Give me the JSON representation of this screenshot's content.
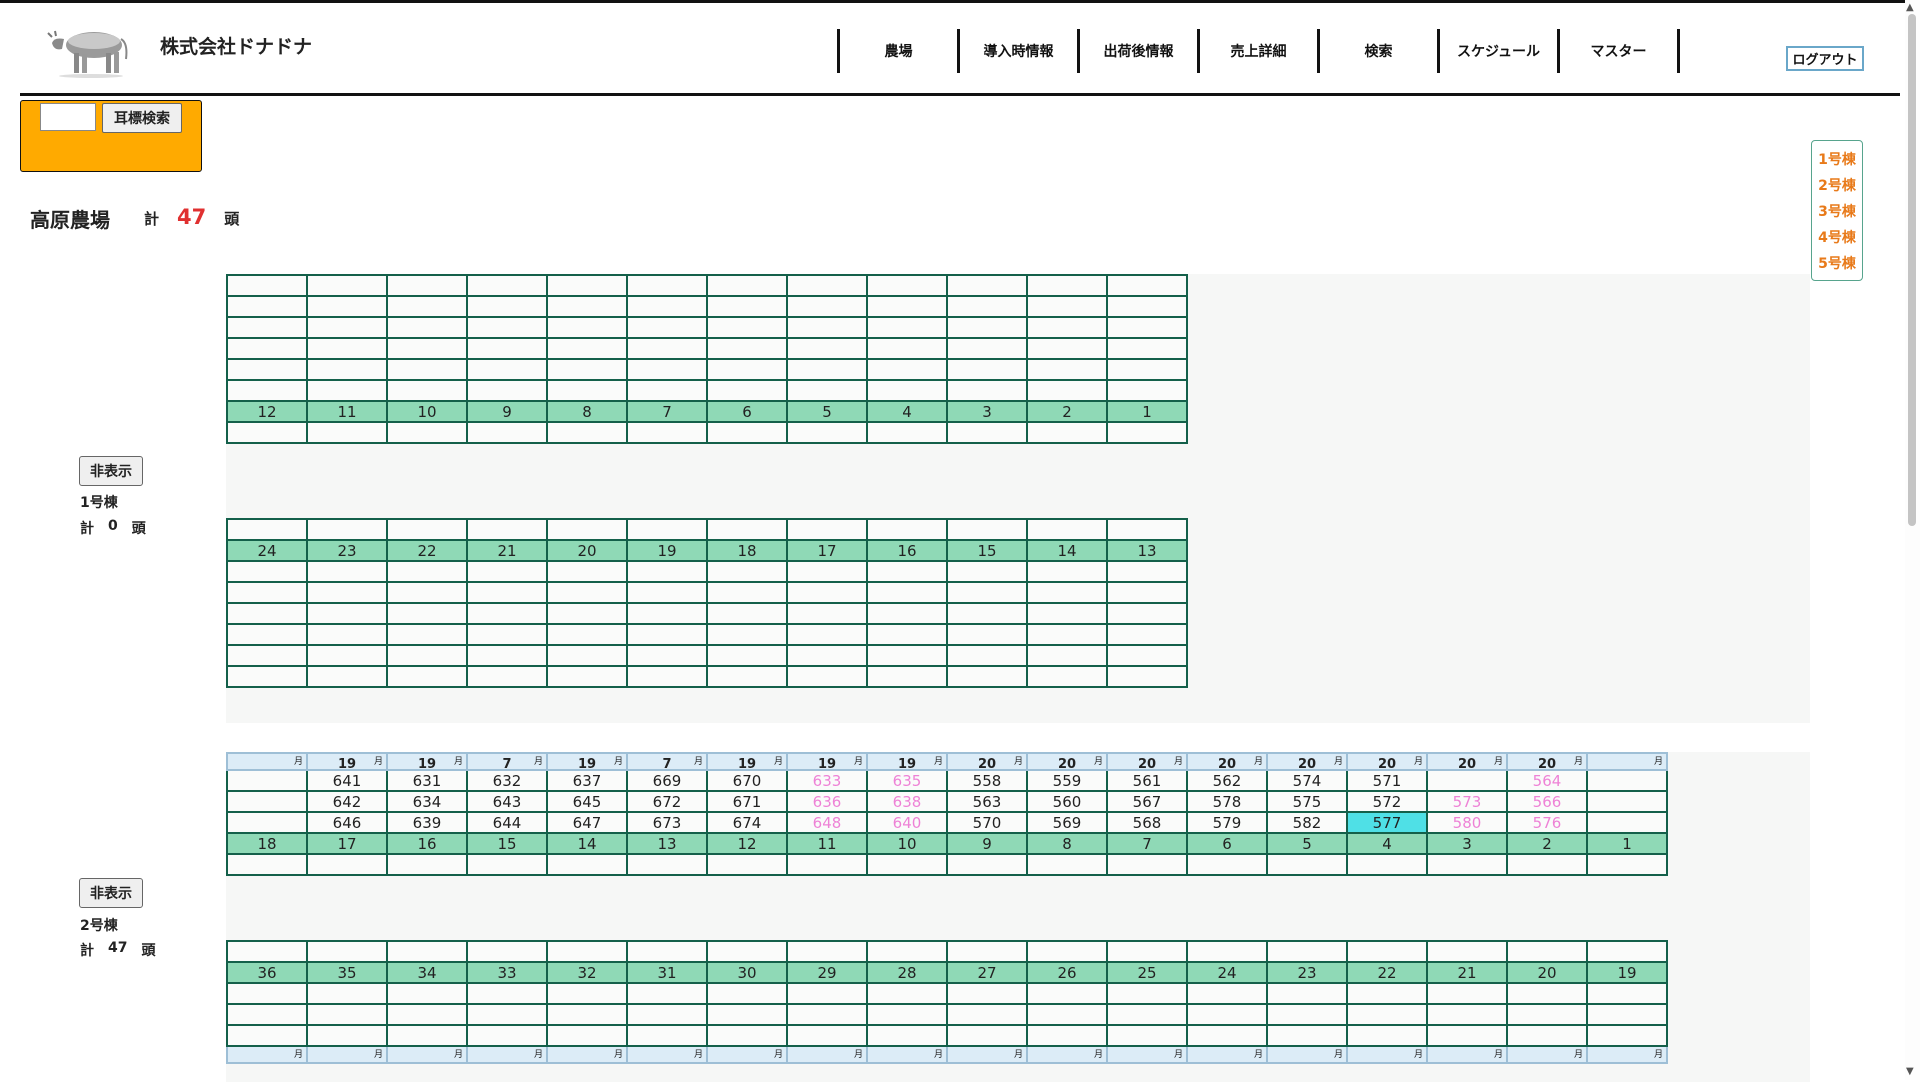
{
  "header": {
    "company": "株式会社ドナドナ",
    "nav": [
      "農場",
      "導入時情報",
      "出荷後情報",
      "売上詳細",
      "検索",
      "スケジュール",
      "マスター"
    ],
    "logout": "ログアウト",
    "logo_icon": "cow-logo"
  },
  "search": {
    "button": "耳標検索",
    "value": ""
  },
  "farm": {
    "name": "高原農場",
    "total_label": "計",
    "total": "47",
    "unit": "頭"
  },
  "barn_nav": [
    "1号棟",
    "2号棟",
    "3号棟",
    "4号棟",
    "5号棟"
  ],
  "barns": [
    {
      "hide_label": "非表示",
      "name": "1号棟",
      "total_label": "計",
      "total": "0",
      "unit": "頭",
      "upper_pens": [
        "12",
        "11",
        "10",
        "9",
        "8",
        "7",
        "6",
        "5",
        "4",
        "3",
        "2",
        "1"
      ],
      "lower_pens": [
        "24",
        "23",
        "22",
        "21",
        "20",
        "19",
        "18",
        "17",
        "16",
        "15",
        "14",
        "13"
      ]
    },
    {
      "hide_label": "非表示",
      "name": "2号棟",
      "total_label": "計",
      "total": "47",
      "unit": "頭",
      "month_unit": "月",
      "dates": [
        "",
        "19",
        "19",
        "7",
        "19",
        "7",
        "19",
        "19",
        "19",
        "20",
        "20",
        "20",
        "20",
        "20",
        "20",
        "20",
        "20",
        ""
      ],
      "cattle_rows": [
        [
          "",
          "641",
          "631",
          "632",
          "637",
          "669",
          "670",
          "633",
          "635",
          "558",
          "559",
          "561",
          "562",
          "574",
          "571",
          "",
          "564",
          ""
        ],
        [
          "",
          "642",
          "634",
          "643",
          "645",
          "672",
          "671",
          "636",
          "638",
          "563",
          "560",
          "567",
          "578",
          "575",
          "572",
          "573",
          "566",
          ""
        ],
        [
          "",
          "646",
          "639",
          "644",
          "647",
          "673",
          "674",
          "648",
          "640",
          "570",
          "569",
          "568",
          "579",
          "582",
          "577",
          "580",
          "576",
          ""
        ]
      ],
      "pink_ids": [
        "633",
        "635",
        "636",
        "638",
        "648",
        "640",
        "573",
        "580",
        "564",
        "566",
        "576"
      ],
      "highlight_ids": [
        "577"
      ],
      "upper_pens": [
        "18",
        "17",
        "16",
        "15",
        "14",
        "13",
        "12",
        "11",
        "10",
        "9",
        "8",
        "7",
        "6",
        "5",
        "4",
        "3",
        "2",
        "1"
      ],
      "lower_pens": [
        "36",
        "35",
        "34",
        "33",
        "32",
        "31",
        "30",
        "29",
        "28",
        "27",
        "26",
        "25",
        "24",
        "23",
        "22",
        "21",
        "20",
        "19"
      ]
    }
  ],
  "colors": {
    "accent_orange": "#ffaa00",
    "pen_green": "#8fd9b6",
    "grid_border": "#14604a",
    "pink_text": "#ee82d6",
    "highlight": "#4fe0e6",
    "total_red": "#e03030"
  }
}
